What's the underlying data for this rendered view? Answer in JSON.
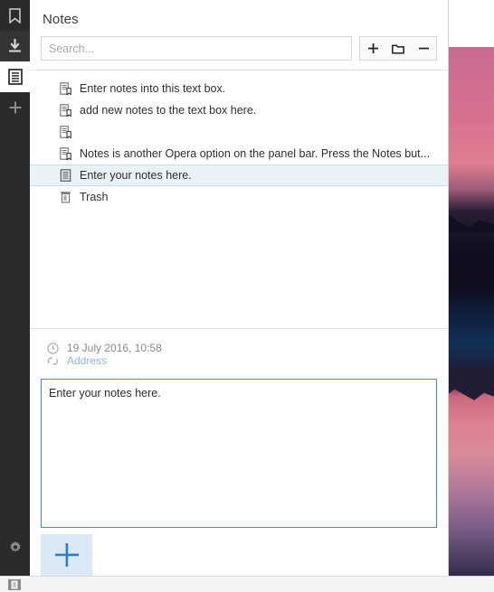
{
  "window": {
    "panel_title": "Notes"
  },
  "sidebar": {
    "items": [
      {
        "name": "bookmarks",
        "icon": "bookmark-icon",
        "active": false
      },
      {
        "name": "downloads",
        "icon": "download-icon",
        "active": false
      },
      {
        "name": "notes",
        "icon": "notes-icon",
        "active": true
      },
      {
        "name": "add-panel",
        "icon": "plus-icon",
        "active": false
      }
    ],
    "settings": {
      "name": "settings",
      "icon": "gear-icon"
    }
  },
  "toolbar": {
    "search_placeholder": "Search...",
    "search_value": "",
    "buttons": [
      {
        "label": "+",
        "icon": "plus-icon",
        "name": "new-note-button"
      },
      {
        "label": "",
        "icon": "folder-icon",
        "name": "new-folder-button"
      },
      {
        "label": "–",
        "icon": "minus-icon",
        "name": "delete-note-button"
      }
    ]
  },
  "note_list": {
    "items": [
      {
        "label": "Enter notes into this text box.",
        "icon": "note-bookmark-icon",
        "selected": false
      },
      {
        "label": "add new notes to the text box here.",
        "icon": "note-bookmark-icon",
        "selected": false
      },
      {
        "label": "",
        "icon": "note-bookmark-icon",
        "selected": false
      },
      {
        "label": "Notes is another Opera option on the panel bar. Press the Notes but...",
        "icon": "note-bookmark-icon",
        "selected": false
      },
      {
        "label": "Enter your notes here.",
        "icon": "note-icon",
        "selected": true
      },
      {
        "label": "Trash",
        "icon": "trash-icon",
        "selected": false
      }
    ]
  },
  "detail": {
    "date": "19 July 2016, 10:58",
    "date_icon": "clock-icon",
    "address_label": "Address",
    "address_icon": "link-icon",
    "note_text": "Enter your notes here.",
    "add_button_label": "+",
    "add_button_icon": "plus-icon"
  },
  "statusbar": {
    "toggle_icon": "panel-toggle-icon"
  },
  "colors": {
    "sidebar_bg": "#2b2b2b",
    "selection_bg": "#e9f1f9",
    "selection_border": "#cddcea",
    "textarea_border": "#3b8dbf",
    "add_button_bg": "#dbe9f6",
    "add_button_fg": "#2f7fc0",
    "link_text": "#8fb5d8",
    "meta_text": "#8a8a8a"
  }
}
